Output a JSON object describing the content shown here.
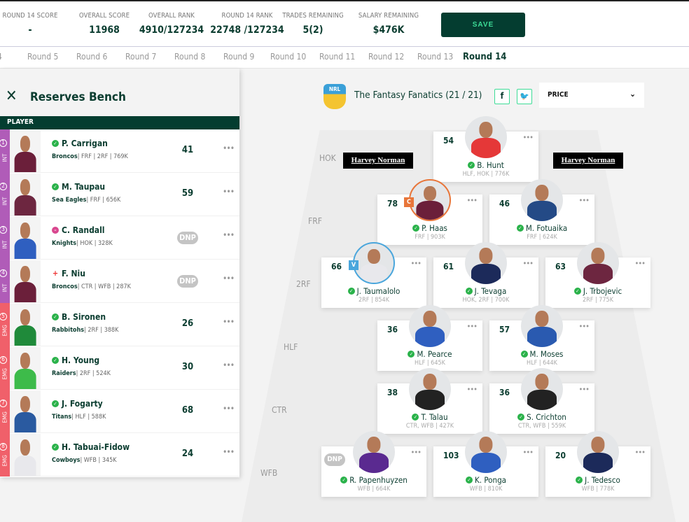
{
  "stats": [
    {
      "label": "ROUND 14 SCORE",
      "value": "-"
    },
    {
      "label": "OVERALL SCORE",
      "value": "11968"
    },
    {
      "label": "OVERALL RANK",
      "value": "4910/127234"
    },
    {
      "label": "ROUND 14 RANK",
      "value": "22748 /127234"
    },
    {
      "label": "TRADES REMAINING",
      "value": "5(2)"
    },
    {
      "label": "SALARY REMAINING",
      "value": "$476K"
    }
  ],
  "save_label": "SAVE",
  "rounds": [
    "4",
    "Round 5",
    "Round 6",
    "Round 7",
    "Round 8",
    "Round 9",
    "Round 10",
    "Round 11",
    "Round 12",
    "Round 13",
    "Round 14"
  ],
  "active_round": "Round 14",
  "bench": {
    "title": "Reserves Bench",
    "column": "PLAYER",
    "players": [
      {
        "num": "1",
        "slot": "INT",
        "name": "P. Carrigan",
        "team": "Broncos",
        "info": "| FRF | 2RF | 769K",
        "score": "41",
        "status": "ok",
        "jersey": "#6b1f3a"
      },
      {
        "num": "2",
        "slot": "INT",
        "name": "M. Taupau",
        "team": "Sea Eagles",
        "info": "| FRF | 656K",
        "score": "59",
        "status": "ok",
        "jersey": "#6d2640"
      },
      {
        "num": "3",
        "slot": "INT",
        "name": "C. Randall",
        "team": "Knights",
        "info": "| HOK | 328K",
        "score": "DNP",
        "status": "pink",
        "jersey": "#2f5fc0"
      },
      {
        "num": "4",
        "slot": "INT",
        "name": "F. Niu",
        "team": "Broncos",
        "info": "| CTR | WFB | 287K",
        "score": "DNP",
        "status": "injured",
        "jersey": "#6b1f3a"
      },
      {
        "num": "5",
        "slot": "EMG",
        "name": "B. Sironen",
        "team": "Rabbitohs",
        "info": "| 2RF | 388K",
        "score": "26",
        "status": "ok",
        "jersey": "#1f8a3a"
      },
      {
        "num": "6",
        "slot": "EMG",
        "name": "H. Young",
        "team": "Raiders",
        "info": "| 2RF | 524K",
        "score": "30",
        "status": "ok",
        "jersey": "#3dbb4a"
      },
      {
        "num": "7",
        "slot": "EMG",
        "name": "J. Fogarty",
        "team": "Titans",
        "info": "| HLF | 588K",
        "score": "68",
        "status": "ok",
        "jersey": "#2a5aa0"
      },
      {
        "num": "8",
        "slot": "EMG",
        "name": "H. Tabuai-Fidow",
        "team": "Cowboys",
        "info": "| WFB | 345K",
        "score": "24",
        "status": "ok",
        "jersey": "#e8e8ec"
      }
    ]
  },
  "team": {
    "logo": "NRL",
    "name": "The Fantasy Fanatics (21 / 21)",
    "facebook": "f",
    "twitter": "t",
    "sort": "PRICE",
    "sponsor": "Harvey Norman"
  },
  "positions": [
    "HOK",
    "FRF",
    "2RF",
    "HLF",
    "CTR",
    "WFB"
  ],
  "field": [
    {
      "score": "54",
      "name": "B. Hunt",
      "meta": "HLF, HOK | 776K",
      "jersey": "#e53838"
    },
    {
      "score": "78",
      "name": "P. Haas",
      "meta": "FRF | 903K",
      "badge": "C",
      "jersey": "#6b1f3a"
    },
    {
      "score": "46",
      "name": "M. Fotuaika",
      "meta": "FRF | 624K",
      "jersey": "#244a86"
    },
    {
      "score": "66",
      "name": "J. Taumalolo",
      "meta": "2RF | 854K",
      "badge": "V",
      "jersey": "#e8e8ec"
    },
    {
      "score": "61",
      "name": "J. Tevaga",
      "meta": "HOK, 2RF | 700K",
      "jersey": "#1c2a5a"
    },
    {
      "score": "63",
      "name": "J. Trbojevic",
      "meta": "2RF | 775K",
      "jersey": "#6d2640"
    },
    {
      "score": "36",
      "name": "M. Pearce",
      "meta": "HLF | 645K",
      "jersey": "#2f5fc0"
    },
    {
      "score": "57",
      "name": "M. Moses",
      "meta": "HLF | 644K",
      "jersey": "#2a5ab0"
    },
    {
      "score": "38",
      "name": "T. Talau",
      "meta": "CTR, WFB | 427K",
      "jersey": "#222"
    },
    {
      "score": "36",
      "name": "S. Crichton",
      "meta": "CTR, WFB | 559K",
      "jersey": "#222"
    },
    {
      "score": "DNP",
      "name": "R. Papenhuyzen",
      "meta": "WFB | 664K",
      "jersey": "#5a2a90"
    },
    {
      "score": "103",
      "name": "K. Ponga",
      "meta": "WFB | 810K",
      "jersey": "#2f5fc0"
    },
    {
      "score": "20",
      "name": "J. Tedesco",
      "meta": "WFB | 778K",
      "jersey": "#1c2a5a"
    }
  ],
  "colors": {
    "primary": "#043d30",
    "accent": "#3ddc97",
    "int": "#b05cb8",
    "emg": "#f0606a",
    "captain": "#e8763a",
    "vice": "#4aa6dc"
  }
}
